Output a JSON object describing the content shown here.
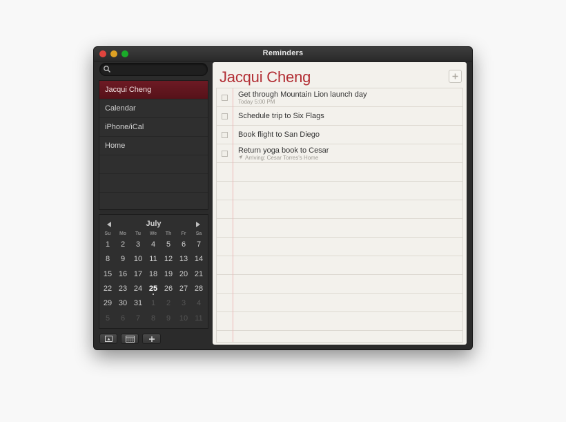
{
  "window": {
    "title": "Reminders"
  },
  "search": {
    "placeholder": ""
  },
  "sidebar": {
    "lists": [
      {
        "label": "Jacqui Cheng",
        "selected": true
      },
      {
        "label": "Calendar",
        "selected": false
      },
      {
        "label": "iPhone/iCal",
        "selected": false
      },
      {
        "label": "Home",
        "selected": false
      }
    ]
  },
  "calendar": {
    "month": "July",
    "weekdays": [
      "Su",
      "Mo",
      "Tu",
      "We",
      "Th",
      "Fr",
      "Sa"
    ],
    "today": 25,
    "weeks": [
      [
        1,
        2,
        3,
        4,
        5,
        6,
        7
      ],
      [
        8,
        9,
        10,
        11,
        12,
        13,
        14
      ],
      [
        15,
        16,
        17,
        18,
        19,
        20,
        21
      ],
      [
        22,
        23,
        24,
        25,
        26,
        27,
        28
      ],
      [
        29,
        30,
        31,
        1,
        2,
        3,
        4
      ],
      [
        5,
        6,
        7,
        8,
        9,
        10,
        11
      ]
    ],
    "dim_after_index": 31
  },
  "list": {
    "title": "Jacqui Cheng",
    "reminders": [
      {
        "title": "Get through Mountain Lion launch day",
        "subtitle": "Today 5:00 PM",
        "has_location": false
      },
      {
        "title": "Schedule trip to Six Flags",
        "subtitle": "",
        "has_location": false
      },
      {
        "title": "Book flight to San Diego",
        "subtitle": "",
        "has_location": false
      },
      {
        "title": "Return yoga book to Cesar",
        "subtitle": "Arriving: Cesar Torres's Home",
        "has_location": true
      }
    ]
  },
  "colors": {
    "accent": "#b22e34",
    "selected_list": "#6d1a24",
    "paper": "#f3f1ec"
  },
  "icons": {
    "search": "search-icon",
    "prev": "chevron-left-icon",
    "next": "chevron-right-icon",
    "add": "plus-icon",
    "location": "location-arrow-icon"
  }
}
